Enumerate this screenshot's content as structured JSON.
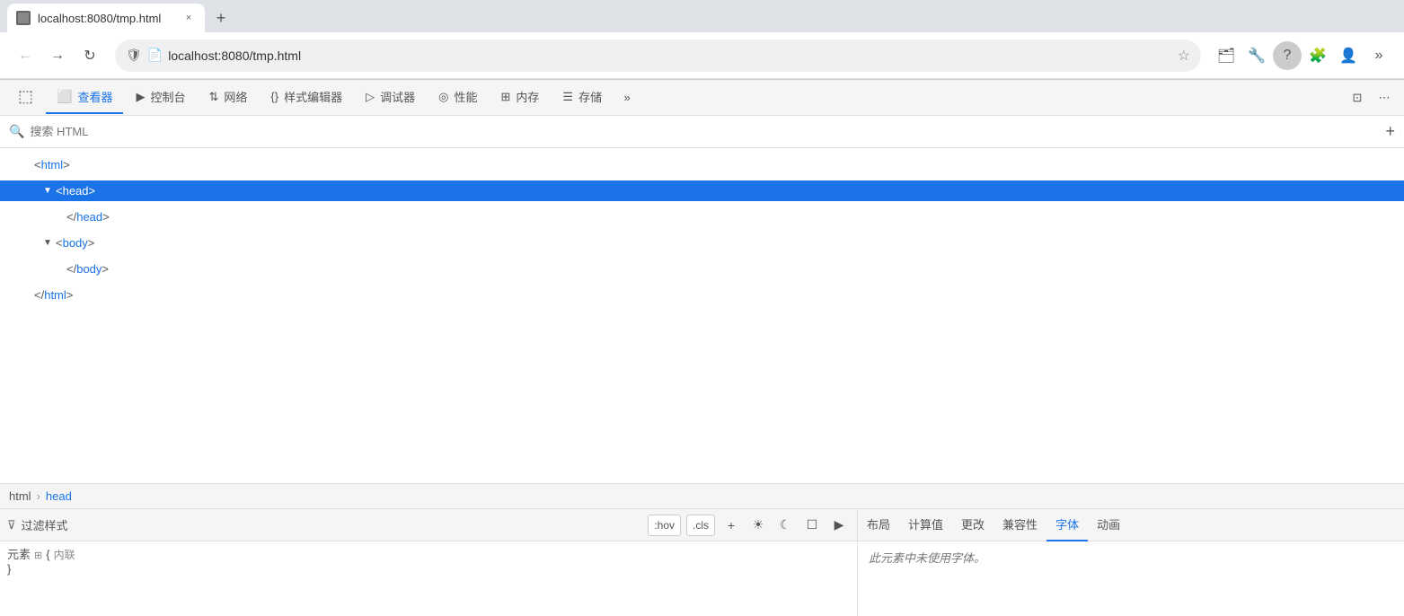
{
  "browser": {
    "tab_title": "localhost:8080/tmp.html",
    "tab_close": "×",
    "new_tab": "+",
    "url": "localhost:8080/tmp.html",
    "back_btn": "←",
    "forward_btn": "→",
    "refresh_btn": "↻"
  },
  "devtools": {
    "tabs": [
      {
        "id": "inspector",
        "icon": "☐",
        "label": "查看器",
        "active": true
      },
      {
        "id": "console",
        "icon": "▶",
        "label": "控制台",
        "active": false
      },
      {
        "id": "network",
        "icon": "⇅",
        "label": "网络",
        "active": false
      },
      {
        "id": "style-editor",
        "icon": "{}",
        "label": "样式编辑器",
        "active": false
      },
      {
        "id": "debugger",
        "icon": "▷",
        "label": "调试器",
        "active": false
      },
      {
        "id": "performance",
        "icon": "◎",
        "label": "性能",
        "active": false
      },
      {
        "id": "memory",
        "icon": "⊞",
        "label": "内存",
        "active": false
      },
      {
        "id": "storage",
        "icon": "☰",
        "label": "存储",
        "active": false
      }
    ],
    "more_tabs": "»",
    "layout_btn": "⊡",
    "menu_btn": "⋯"
  },
  "inspector": {
    "search_placeholder": "搜索 HTML",
    "add_btn": "+",
    "html_tree": [
      {
        "id": "html-open",
        "indent": "indent1",
        "text": "<html>",
        "has_triangle": false,
        "triangle": "",
        "selected": false
      },
      {
        "id": "head-open",
        "indent": "indent2",
        "text": "<head>",
        "has_triangle": true,
        "triangle": "▼",
        "selected": true
      },
      {
        "id": "head-close",
        "indent": "indent2",
        "text": "</head>",
        "has_triangle": false,
        "triangle": "",
        "selected": false
      },
      {
        "id": "body-open",
        "indent": "indent2",
        "text": "<body>",
        "has_triangle": true,
        "triangle": "▼",
        "selected": false
      },
      {
        "id": "body-close",
        "indent": "indent2",
        "text": "</body>",
        "has_triangle": false,
        "triangle": "",
        "selected": false
      },
      {
        "id": "html-close",
        "indent": "indent1",
        "text": "</html>",
        "has_triangle": false,
        "triangle": "",
        "selected": false
      }
    ]
  },
  "breadcrumb": {
    "items": [
      {
        "id": "html",
        "label": "html",
        "active": false
      },
      {
        "id": "head",
        "label": "head",
        "active": true
      }
    ],
    "separator": "›"
  },
  "styles_panel": {
    "filter_icon": "⊽",
    "filter_placeholder": "过滤样式",
    "hov_btn": ":hov",
    "cls_btn": ".cls",
    "add_btn": "+",
    "light_btn": "☀",
    "dark_btn": "☾",
    "screenshot_btn": "☐",
    "element_label": "元素",
    "grid_icon": "⊞",
    "brace_open": "{",
    "inline_label": "内联",
    "brace_close": "}",
    "right_tabs": [
      {
        "id": "layout",
        "label": "布局",
        "active": false
      },
      {
        "id": "computed",
        "label": "计算值",
        "active": false
      },
      {
        "id": "changes",
        "label": "更改",
        "active": false
      },
      {
        "id": "compat",
        "label": "兼容性",
        "active": false
      },
      {
        "id": "fonts",
        "label": "字体",
        "active": true
      },
      {
        "id": "animation",
        "label": "动画",
        "active": false
      }
    ],
    "font_empty_msg": "此元素中未使用字体。",
    "play_icon": "▶"
  }
}
